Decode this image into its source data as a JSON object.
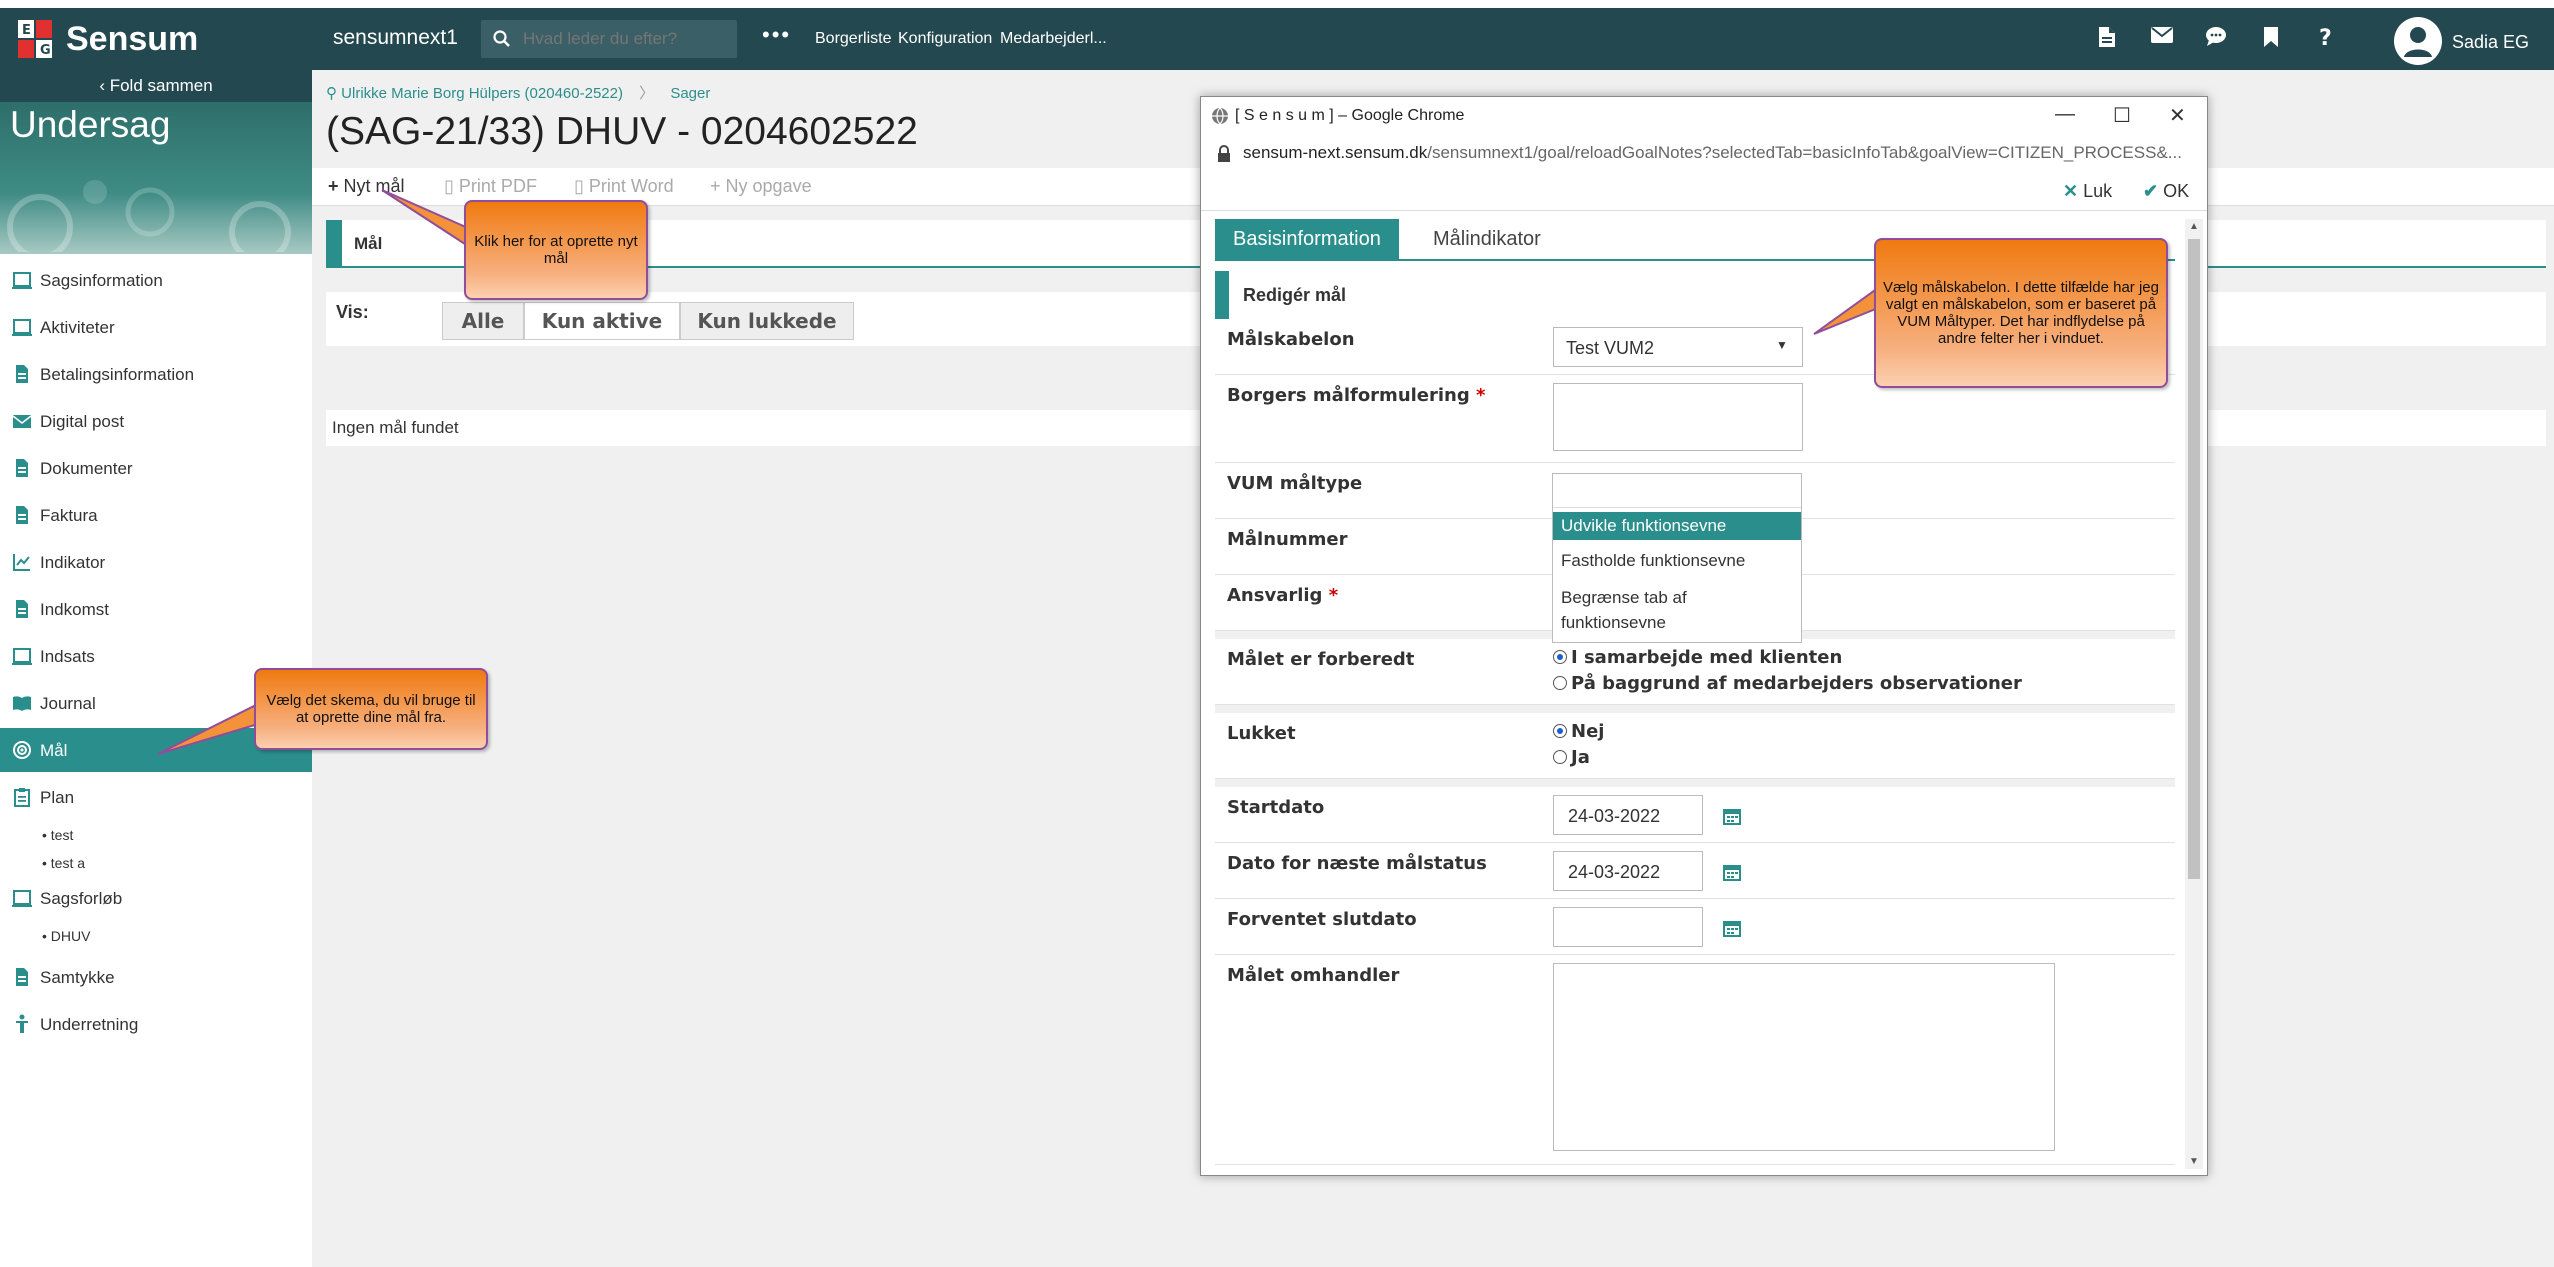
{
  "header": {
    "logo": "Sensum",
    "system": "sensumnext1",
    "search_placeholder": "Hvad leder du efter?",
    "more": "•••",
    "nav": [
      "Borgerliste",
      "Konfiguration",
      "Medarbejderl..."
    ],
    "user": "Sadia EG"
  },
  "sidebar": {
    "fold": "Fold sammen",
    "title": "Undersag",
    "items": [
      {
        "label": "Sagsinformation",
        "icon": "case-icon"
      },
      {
        "label": "Aktiviteter",
        "icon": "activity-icon"
      },
      {
        "label": "Betalingsinformation",
        "icon": "document-icon"
      },
      {
        "label": "Digital post",
        "icon": "envelope-icon"
      },
      {
        "label": "Dokumenter",
        "icon": "document-icon"
      },
      {
        "label": "Faktura",
        "icon": "document-icon"
      },
      {
        "label": "Indikator",
        "icon": "chart-icon"
      },
      {
        "label": "Indkomst",
        "icon": "document-icon"
      },
      {
        "label": "Indsats",
        "icon": "case-icon"
      },
      {
        "label": "Journal",
        "icon": "book-icon"
      },
      {
        "label": "Mål",
        "icon": "target-icon"
      },
      {
        "label": "Plan",
        "icon": "clipboard-icon"
      },
      {
        "label": "Sagsforløb",
        "icon": "case-icon"
      },
      {
        "label": "Samtykke",
        "icon": "document-icon"
      },
      {
        "label": "Underretning",
        "icon": "person-icon"
      }
    ],
    "plan_sub": [
      "• test",
      "• test a"
    ],
    "forlob_sub": [
      "• DHUV"
    ]
  },
  "main": {
    "breadcrumb": [
      "Ulrikke Marie Borg Hülpers (020460-2522)",
      "Sager"
    ],
    "title": "(SAG-21/33) DHUV - 0204602522",
    "toolbar": {
      "new_goal": "Nyt mål",
      "print_pdf": "Print PDF",
      "print_word": "Print Word",
      "new_task": "Ny opgave"
    },
    "section": "Mål",
    "vis_label": "Vis:",
    "filters": [
      "Alle",
      "Kun aktive",
      "Kun lukkede"
    ],
    "empty": "Ingen mål fundet"
  },
  "callouts": {
    "new_goal": "Klik her for at oprette nyt mål",
    "choose_schema": "Vælg det skema, du vil bruge til at oprette dine mål fra.",
    "template": "Vælg målskabelon. I dette tilfælde har jeg valgt en målskabelon, som er baseret på VUM Måltyper. Det har indflydelse på andre felter her i vinduet."
  },
  "popup": {
    "window_title": "[ S e n s u m ] – Google Chrome",
    "url_host": "sensum-next.sensum.dk",
    "url_path": "/sensumnext1/goal/reloadGoalNotes?selectedTab=basicInfoTab&goalView=CITIZEN_PROCESS&...",
    "close": "Luk",
    "ok": "OK",
    "tabs": [
      "Basisinformation",
      "Målindikator"
    ],
    "form_title": "Redigér mål",
    "fields": {
      "template_label": "Målskabelon",
      "template_value": "Test VUM2",
      "formulation_label": "Borgers målformulering",
      "vum_label": "VUM måltype",
      "number_label": "Målnummer",
      "responsible_label": "Ansvarlig",
      "prepared_label": "Målet er forberedt",
      "closed_label": "Lukket",
      "start_label": "Startdato",
      "start_value": "24-03-2022",
      "next_status_label": "Dato for næste målstatus",
      "next_status_value": "24-03-2022",
      "end_label": "Forventet slutdato",
      "about_label": "Målet omhandler"
    },
    "req_mark": "*",
    "vum_options": [
      "Udvikle funktionsevne",
      "Fastholde funktionsevne",
      "Begrænse tab af funktionsevne"
    ],
    "prepared_options": [
      "I samarbejde med klienten",
      "På baggrund af medarbejders observationer"
    ],
    "closed_options": [
      "Nej",
      "Ja"
    ]
  },
  "colors": {
    "topbar": "#23484f",
    "accent": "#2a8f8c",
    "callout": "#f07a10"
  }
}
